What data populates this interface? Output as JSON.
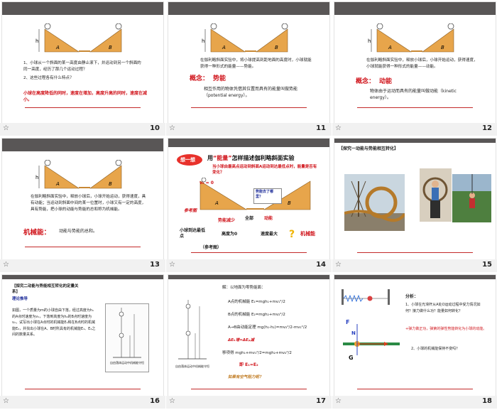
{
  "slides": [
    {
      "num": "10",
      "q1": "1、小球从一个斜面的某一高度由静止滚下，并运动到另一个斜面的同一高度，经历了那几个运动过程？",
      "q2": "2、这些过程各有什么特点？",
      "ans": "小球在高度降低的同时，速度在增加，高度升高的同时，速度在减小。"
    },
    {
      "num": "11",
      "text": "在伽利略斜面实验中，将小球提高到距地面的高度时，小球就能获得一种形式的能量——势能。",
      "concept_label": "概念：",
      "concept_value": "势能",
      "def": "相互作用的物体凭借其位置而具有的能量叫做势能（potential energy）。"
    },
    {
      "num": "12",
      "text": "在伽利略斜面实验中，释放小球后，小球开始运动，获得速度，小球就能获得一种形式的能量——动能。",
      "concept_label": "概念：",
      "concept_value": "动能",
      "def": "物体由于运动而具有的能量叫做动能（kinetic energy）。"
    },
    {
      "num": "13",
      "text": "在伽利略斜面实验中，释放小球后，小球开始运动，获得速度，具有动能；当运动到斜面中间的某一位置时，小球又有一定的高度，具有势能，把小球的动能与势能的总和称为机械能。",
      "label": "机械能：",
      "def": "动能与势能的总和。"
    },
    {
      "num": "14",
      "bubble": "想一想",
      "title_pre": "用",
      "title_quote": "“能量”",
      "title_post": "怎样描述伽利略斜面实验",
      "sub": "当小球由最高点运动到斜面A运动到达最低点时，能量是否有变化？",
      "v0": "v₀ = 0",
      "ref1": "参考图",
      "mid": "势能减少",
      "all": "全部",
      "kin": "动能",
      "b_q": "势能去了哪里？",
      "low": "小球到达最低点",
      "height0": "高度为0",
      "vmax": "速度最大",
      "mech": "机械能",
      "ref2": "（参考图）",
      "label_A": "A",
      "label_B": "B"
    },
    {
      "num": "15",
      "title": "【探究一动能与势能相互转化】"
    },
    {
      "num": "16",
      "title": "【探究二动能与势能相互转化的定量关系】",
      "sub": "理论推导",
      "text": "如图，一个质量为m的小球自由下落，经过高度为h₁的A点时速度为v₁，下落到高度为h₂的B点时速度为v₂，试写出小球在A点时的机械能E₁和在B点时的机械能E₂，并找出小球在A、B时所具有的机械能E₁、E₂之间的数量关系。",
      "caption": "自由落体运动中机械能守恒"
    },
    {
      "num": "17",
      "l1": "解：以地面为零势能面：",
      "l2": "A点的机械能 E₁=mgh₁+mv₁²/2",
      "l3": "B点的机械能 E₂=mgh₂+mv₂²/2",
      "l4": "A→B由动能定理 mg(h₁-h₂)=mv₂²/2-mv₁²/2",
      "l5": "ΔEₖ增=ΔEₚ减",
      "l6": "移项得 mgh₁+mv₁²/2=mgh₂+mv₂²/2",
      "l7": "即 E₁=E₂",
      "l8": "如果有空气阻力呢？",
      "caption": "自由落体运动中机械能守恒"
    },
    {
      "num": "18",
      "a_title": "分析：",
      "a1": "1、小球在光滑杆从A处O运动过程中受力情况如何？接力做什么功？能量如何转化？",
      "a2": "+弹力做正功，弹簧的弹性势能转化为小球的动能。",
      "a3": "2、小球的机械能保持不变吗？",
      "F": "F",
      "N": "N",
      "G": "G"
    }
  ],
  "footer_star": "☆"
}
